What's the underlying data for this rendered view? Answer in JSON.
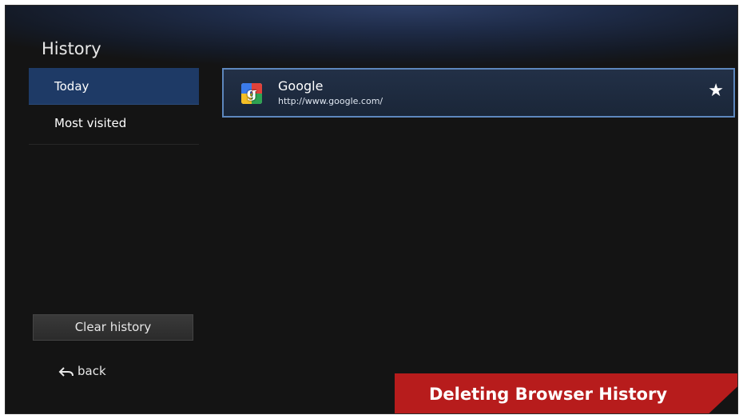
{
  "title": "History",
  "sidebar": {
    "items": [
      {
        "label": "Today",
        "active": true
      },
      {
        "label": "Most visited",
        "active": false
      }
    ],
    "clear_label": "Clear history",
    "back_label": "back"
  },
  "history": {
    "items": [
      {
        "title": "Google",
        "url": "http://www.google.com/",
        "icon": "google-favicon-icon",
        "bookmarked": true
      }
    ]
  },
  "banner": {
    "text": "Deleting Browser History"
  },
  "colors": {
    "selected_bg": "#1e3a66",
    "row_border": "#5d87bd",
    "banner_red": "#b71c1c",
    "screen_bg": "#141414"
  }
}
